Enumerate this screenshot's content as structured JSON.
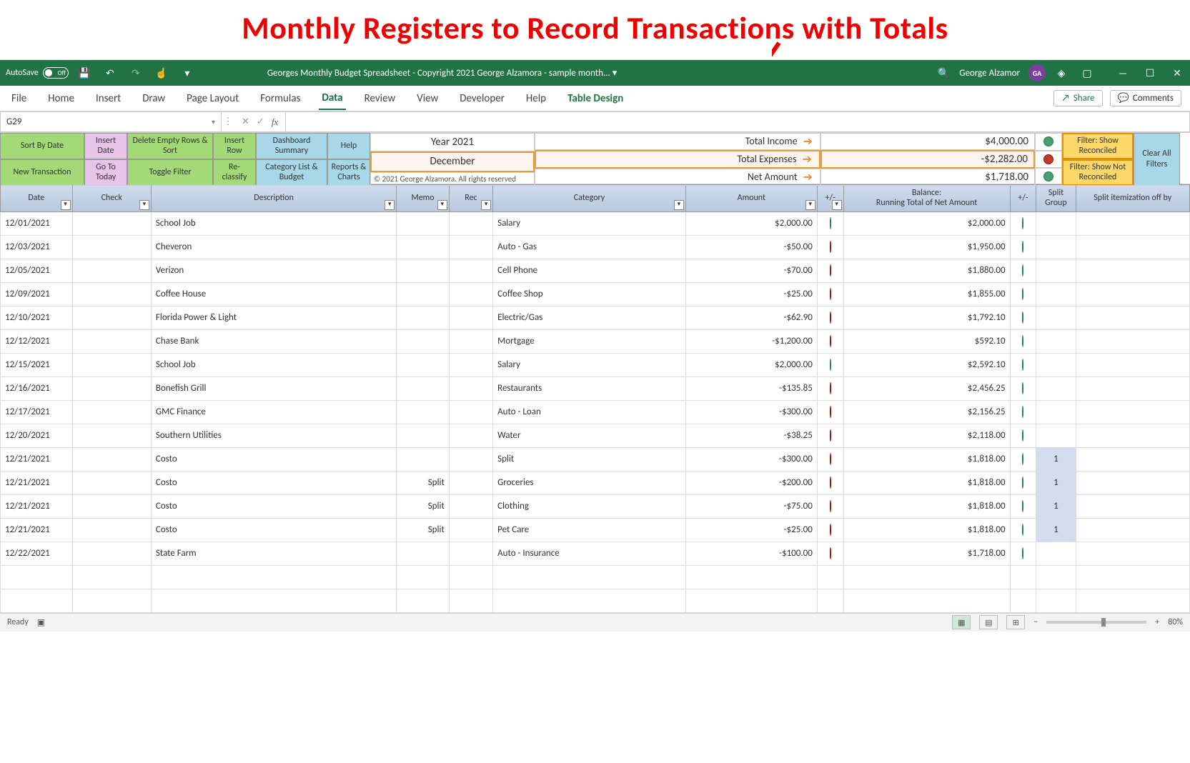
{
  "annotation": "Monthly Registers to Record Transactions with Totals",
  "titlebar": {
    "autosave_label": "AutoSave",
    "autosave_state": "Off",
    "doc_title": "Georges Monthly Budget Spreadsheet - Copyright 2021 George Alzamora - sample month... ▾",
    "user_name": "George Alzamor",
    "user_initials": "GA"
  },
  "ribbon": {
    "tabs": [
      "File",
      "Home",
      "Insert",
      "Draw",
      "Page Layout",
      "Formulas",
      "Data",
      "Review",
      "View",
      "Developer",
      "Help",
      "Table Design"
    ],
    "active": "Data",
    "share": "Share",
    "comments": "Comments"
  },
  "formula_bar": {
    "name_box": "G29",
    "formula": ""
  },
  "buttons": {
    "sort_by_date": "Sort By Date",
    "new_transaction": "New Transaction",
    "insert_date": "Insert Date",
    "goto_today": "Go To Today",
    "delete_empty_sort": "Delete Empty Rows & Sort",
    "toggle_filter": "Toggle Filter",
    "insert_row": "Insert Row",
    "reclassify": "Re-classify",
    "dashboard_summary": "Dashboard Summary",
    "category_list_budget": "Category List & Budget",
    "help": "Help",
    "reports_charts": "Reports & Charts",
    "filter_show_reconciled": "Filter: Show Reconciled",
    "filter_show_not_reconciled": "Filter: Show Not Reconciled",
    "clear_all_filters": "Clear All Filters"
  },
  "summary": {
    "year": "Year 2021",
    "month": "December",
    "total_income_label": "Total Income",
    "total_expenses_label": "Total Expenses",
    "net_amount_label": "Net Amount",
    "total_income": "$4,000.00",
    "total_expenses": "-$2,282.00",
    "net_amount": "$1,718.00",
    "copyright": "© 2021 George Alzamora. All rights reserved"
  },
  "columns": {
    "date": "Date",
    "check": "Check",
    "description": "Description",
    "memo": "Memo",
    "rec": "Rec",
    "category": "Category",
    "amount": "Amount",
    "pm1": "+/-",
    "balance": "Balance:\nRunning Total of Net Amount",
    "pm2": "+/-",
    "split_group": "Split Group",
    "split_item": "Split itemization off by"
  },
  "rows": [
    {
      "date": "12/01/2021",
      "desc": "School Job",
      "memo": "",
      "category": "Salary",
      "amount": "$2,000.00",
      "dot": "green",
      "balance": "$2,000.00",
      "bdot": "green",
      "split": ""
    },
    {
      "date": "12/03/2021",
      "desc": "Cheveron",
      "memo": "",
      "category": "Auto - Gas",
      "amount": "-$50.00",
      "dot": "red",
      "balance": "$1,950.00",
      "bdot": "green",
      "split": ""
    },
    {
      "date": "12/05/2021",
      "desc": "Verizon",
      "memo": "",
      "category": "Cell Phone",
      "amount": "-$70.00",
      "dot": "red",
      "balance": "$1,880.00",
      "bdot": "green",
      "split": ""
    },
    {
      "date": "12/09/2021",
      "desc": "Coffee House",
      "memo": "",
      "category": "Coffee Shop",
      "amount": "-$25.00",
      "dot": "red",
      "balance": "$1,855.00",
      "bdot": "green",
      "split": ""
    },
    {
      "date": "12/10/2021",
      "desc": "Florida Power & Light",
      "memo": "",
      "category": "Electric/Gas",
      "amount": "-$62.90",
      "dot": "red",
      "balance": "$1,792.10",
      "bdot": "green",
      "split": ""
    },
    {
      "date": "12/12/2021",
      "desc": "Chase Bank",
      "memo": "",
      "category": "Mortgage",
      "amount": "-$1,200.00",
      "dot": "red",
      "balance": "$592.10",
      "bdot": "green",
      "split": ""
    },
    {
      "date": "12/15/2021",
      "desc": "School Job",
      "memo": "",
      "category": "Salary",
      "amount": "$2,000.00",
      "dot": "green",
      "balance": "$2,592.10",
      "bdot": "green",
      "split": ""
    },
    {
      "date": "12/16/2021",
      "desc": "Bonefish Grill",
      "memo": "",
      "category": "Restaurants",
      "amount": "-$135.85",
      "dot": "red",
      "balance": "$2,456.25",
      "bdot": "green",
      "split": ""
    },
    {
      "date": "12/17/2021",
      "desc": "GMC Finance",
      "memo": "",
      "category": "Auto - Loan",
      "amount": "-$300.00",
      "dot": "red",
      "balance": "$2,156.25",
      "bdot": "green",
      "split": ""
    },
    {
      "date": "12/20/2021",
      "desc": "Southern Utilities",
      "memo": "",
      "category": "Water",
      "amount": "-$38.25",
      "dot": "red",
      "balance": "$2,118.00",
      "bdot": "green",
      "split": ""
    },
    {
      "date": "12/21/2021",
      "desc": "Costo",
      "memo": "",
      "category": "Split",
      "amount": "-$300.00",
      "dot": "red",
      "balance": "$1,818.00",
      "bdot": "green",
      "split": "1"
    },
    {
      "date": "12/21/2021",
      "desc": "Costo",
      "memo": "Split",
      "category": "Groceries",
      "amount": "-$200.00",
      "dot": "red",
      "balance": "$1,818.00",
      "bdot": "green",
      "split": "1"
    },
    {
      "date": "12/21/2021",
      "desc": "Costo",
      "memo": "Split",
      "category": "Clothing",
      "amount": "-$75.00",
      "dot": "red",
      "balance": "$1,818.00",
      "bdot": "green",
      "split": "1"
    },
    {
      "date": "12/21/2021",
      "desc": "Costo",
      "memo": "Split",
      "category": "Pet Care",
      "amount": "-$25.00",
      "dot": "red",
      "balance": "$1,818.00",
      "bdot": "green",
      "split": "1"
    },
    {
      "date": "12/22/2021",
      "desc": "State Farm",
      "memo": "",
      "category": "Auto - Insurance",
      "amount": "-$100.00",
      "dot": "red",
      "balance": "$1,718.00",
      "bdot": "green",
      "split": ""
    }
  ],
  "statusbar": {
    "ready": "Ready",
    "zoom": "80%"
  }
}
